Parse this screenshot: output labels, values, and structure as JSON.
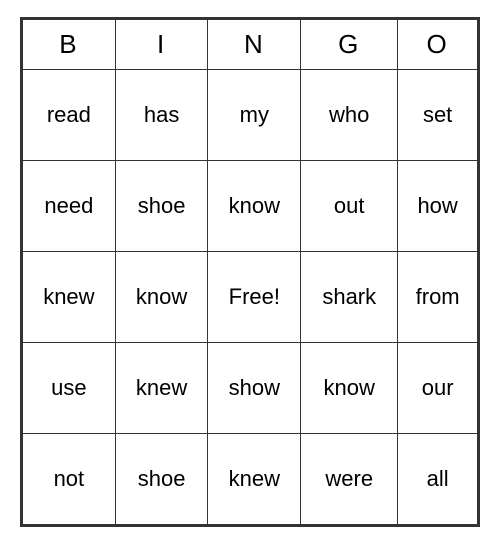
{
  "header": {
    "cols": [
      "B",
      "I",
      "N",
      "G",
      "O"
    ]
  },
  "rows": [
    [
      "read",
      "has",
      "my",
      "who",
      "set"
    ],
    [
      "need",
      "shoe",
      "know",
      "out",
      "how"
    ],
    [
      "knew",
      "know",
      "Free!",
      "shark",
      "from"
    ],
    [
      "use",
      "knew",
      "show",
      "know",
      "our"
    ],
    [
      "not",
      "shoe",
      "knew",
      "were",
      "all"
    ]
  ]
}
